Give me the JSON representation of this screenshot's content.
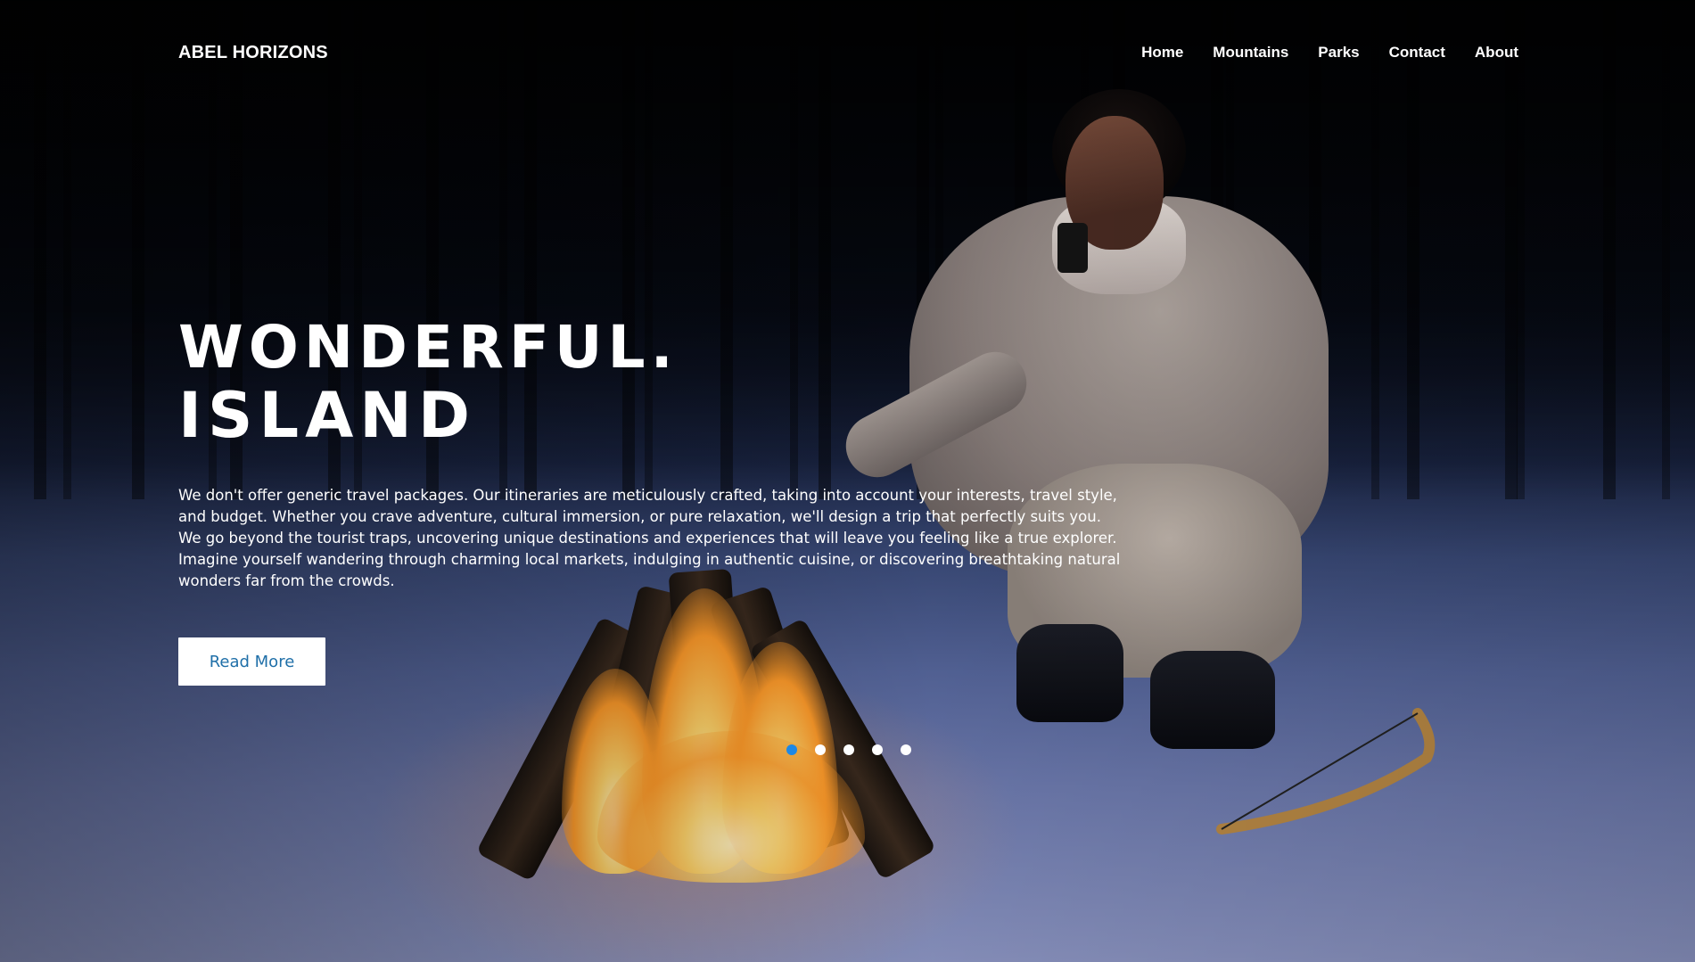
{
  "brand": {
    "name": "ABEL HORIZONS"
  },
  "nav": {
    "items": [
      {
        "label": "Home"
      },
      {
        "label": "Mountains"
      },
      {
        "label": "Parks"
      },
      {
        "label": "Contact"
      },
      {
        "label": "About"
      }
    ]
  },
  "hero": {
    "title_line1": "WONDERFUL.",
    "title_line2": "ISLAND",
    "description": "We don't offer generic travel packages. Our itineraries are meticulously crafted, taking into account your interests, travel style, and budget. Whether you crave adventure, cultural immersion, or pure relaxation, we'll design a trip that perfectly suits you. We go beyond the tourist traps, uncovering unique destinations and experiences that will leave you feeling like a true explorer. Imagine yourself wandering through charming local markets, indulging in authentic cuisine, or discovering breathtaking natural wonders far from the crowds.",
    "cta_label": "Read More",
    "background_image": "campfire-snow-woman-photo"
  },
  "slider": {
    "dot_count": 5,
    "active_index": 0,
    "active_color": "#1e88e5",
    "inactive_color": "#ffffff"
  },
  "colors": {
    "cta_text": "#1f6fa8",
    "cta_bg": "#ffffff",
    "text": "#ffffff"
  }
}
